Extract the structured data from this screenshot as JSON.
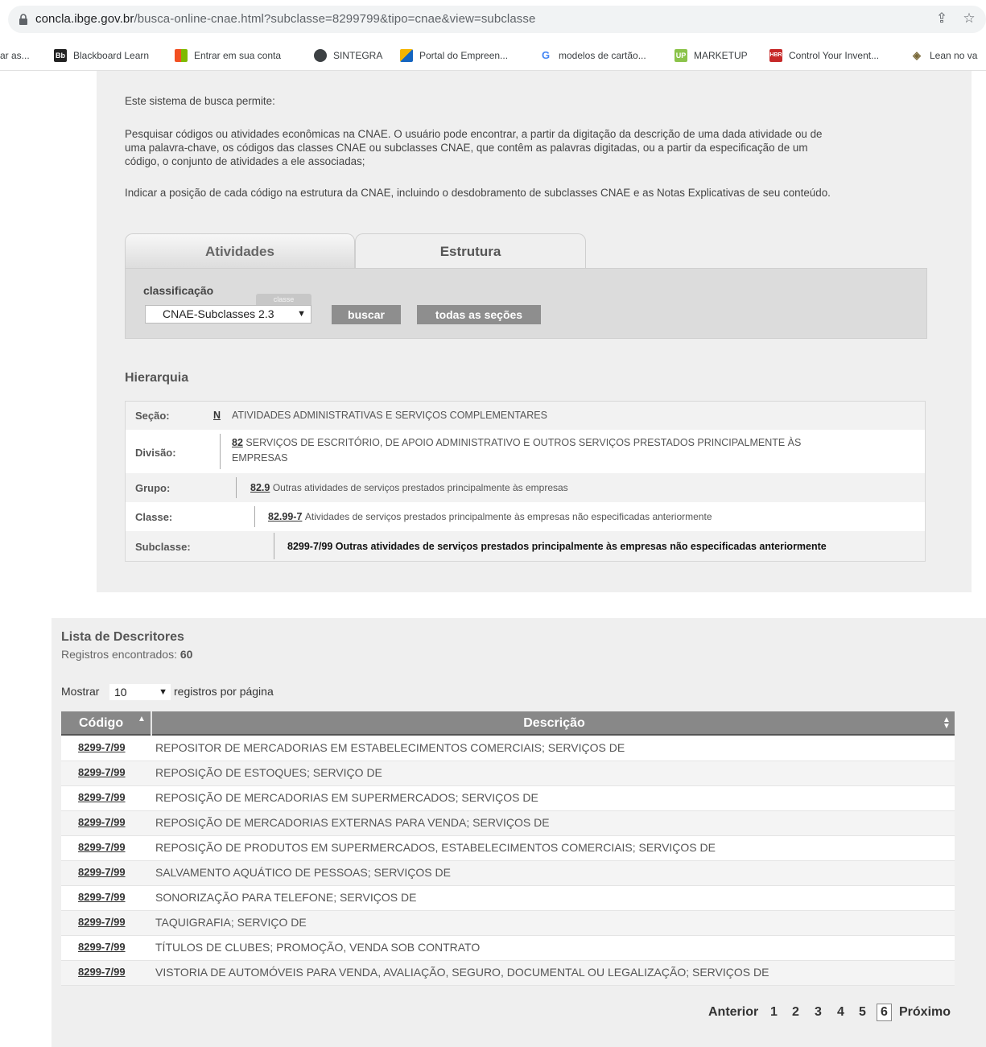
{
  "browser": {
    "url_host": "concla.ibge.gov.br",
    "url_path": "/busca-online-cnae.html?subclasse=8299799&tipo=cnae&view=subclasse",
    "bookmarks": [
      {
        "label": "ar as...",
        "icon": ""
      },
      {
        "label": "Blackboard Learn",
        "icon": "Bb"
      },
      {
        "label": "Entrar em sua conta",
        "icon": "windows-logo"
      },
      {
        "label": "SINTEGRA",
        "icon": "globe-icon"
      },
      {
        "label": "Portal do Empreen...",
        "icon": "portal-logo"
      },
      {
        "label": "modelos de cartão...",
        "icon": "google-logo"
      },
      {
        "label": "MARKETUP",
        "icon": "UP"
      },
      {
        "label": "Control Your Invent...",
        "icon": "HBR"
      },
      {
        "label": "Lean no va",
        "icon": "lean-logo"
      }
    ]
  },
  "intro": {
    "line1": "Este sistema de busca permite:",
    "para1_l1": "Pesquisar códigos ou atividades econômicas na CNAE. O usuário pode encontrar, a partir da digitação da descrição de uma dada atividade ou de",
    "para1_l2": "uma palavra-chave, os códigos das classes CNAE ou subclasses CNAE, que contêm as palavras digitadas, ou a partir da especificação de um",
    "para1_l3": "código, o conjunto de atividades a ele associadas;",
    "para2": "Indicar a posição de cada código na estrutura da CNAE, incluindo o desdobramento de subclasses CNAE e as Notas Explicativas de seu conteúdo."
  },
  "tabs": {
    "atividades": "Atividades",
    "estrutura": "Estrutura"
  },
  "search": {
    "classificacao_label": "classificação",
    "mini_tag": "classe",
    "select_value": "CNAE-Subclasses 2.3",
    "buscar": "buscar",
    "todas": "todas as seções"
  },
  "hierarquia": {
    "title": "Hierarquia",
    "secao_key": "Seção:",
    "secao_code": "N",
    "secao_text": "ATIVIDADES ADMINISTRATIVAS E SERVIÇOS COMPLEMENTARES",
    "divisao_key": "Divisão:",
    "divisao_code": "82",
    "divisao_text_l1": "SERVIÇOS DE ESCRITÓRIO, DE APOIO ADMINISTRATIVO E OUTROS SERVIÇOS PRESTADOS PRINCIPALMENTE ÀS",
    "divisao_text_l2": "EMPRESAS",
    "grupo_key": "Grupo:",
    "grupo_code": "82.9",
    "grupo_text": "Outras atividades de serviços prestados principalmente às empresas",
    "classe_key": "Classe:",
    "classe_code": "82.99-7",
    "classe_text": "Atividades de serviços prestados principalmente às empresas não especificadas anteriormente",
    "subclasse_key": "Subclasse:",
    "subclasse_text": "8299-7/99 Outras atividades de serviços prestados principalmente às empresas não especificadas anteriormente"
  },
  "lista": {
    "title": "Lista de Descritores",
    "registros_label": "Registros encontrados:",
    "registros_count": "60",
    "mostrar": "Mostrar",
    "per_page": "10",
    "por_pagina": "registros por página",
    "col_codigo": "Código",
    "col_descricao": "Descrição",
    "rows": [
      {
        "code": "8299-7/99",
        "desc": "REPOSITOR DE MERCADORIAS EM ESTABELECIMENTOS COMERCIAIS; SERVIÇOS DE"
      },
      {
        "code": "8299-7/99",
        "desc": "REPOSIÇÃO DE ESTOQUES; SERVIÇO DE"
      },
      {
        "code": "8299-7/99",
        "desc": "REPOSIÇÃO DE MERCADORIAS EM SUPERMERCADOS; SERVIÇOS DE"
      },
      {
        "code": "8299-7/99",
        "desc": "REPOSIÇÃO DE MERCADORIAS EXTERNAS PARA VENDA; SERVIÇOS DE"
      },
      {
        "code": "8299-7/99",
        "desc": "REPOSIÇÃO DE PRODUTOS EM SUPERMERCADOS, ESTABELECIMENTOS COMERCIAIS; SERVIÇOS DE"
      },
      {
        "code": "8299-7/99",
        "desc": "SALVAMENTO AQUÁTICO DE PESSOAS; SERVIÇOS DE"
      },
      {
        "code": "8299-7/99",
        "desc": "SONORIZAÇÃO PARA TELEFONE; SERVIÇOS DE"
      },
      {
        "code": "8299-7/99",
        "desc": "TAQUIGRAFIA; SERVIÇO DE"
      },
      {
        "code": "8299-7/99",
        "desc": "TÍTULOS DE CLUBES; PROMOÇÃO, VENDA SOB CONTRATO"
      },
      {
        "code": "8299-7/99",
        "desc": "VISTORIA DE AUTOMÓVEIS PARA VENDA, AVALIAÇÃO, SEGURO, DOCUMENTAL OU LEGALIZAÇÃO; SERVIÇOS DE"
      }
    ],
    "pager": {
      "anterior": "Anterior",
      "p1": "1",
      "p2": "2",
      "p3": "3",
      "p4": "4",
      "p5": "5",
      "p6": "6",
      "proximo": "Próximo"
    }
  }
}
